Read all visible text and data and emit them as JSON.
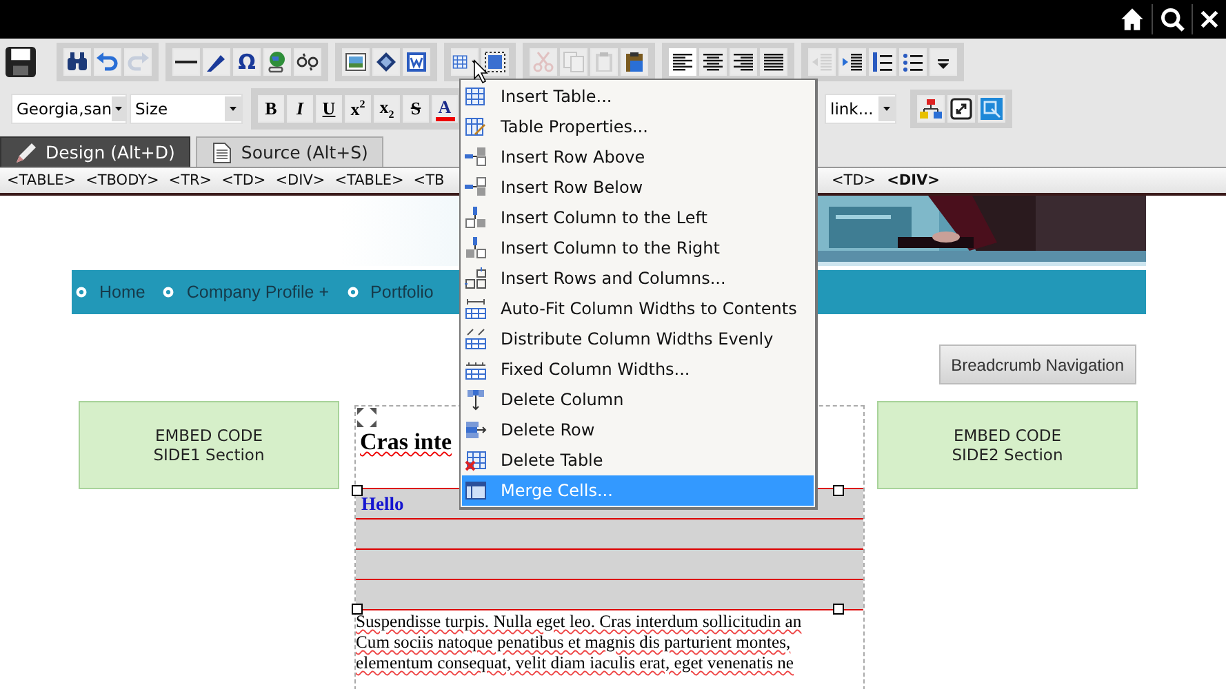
{
  "toolbar": {
    "row_1": [
      [
        {
          "disabled": false
        }
      ],
      [
        {
          "disabled": false
        },
        {
          "disabled": false
        },
        {
          "disabled": true
        }
      ],
      [
        {
          "disabled": false
        },
        {
          "disabled": false
        },
        {
          "label": "Ω",
          "disabled": false
        },
        {
          "disabled": false
        },
        {
          "disabled": false
        }
      ],
      [
        {
          "disabled": false
        },
        {
          "disabled": false
        },
        {
          "disabled": false
        }
      ],
      [
        {
          "disabled": false
        },
        {
          "disabled": false
        }
      ],
      [
        {
          "disabled": true
        },
        {
          "disabled": true
        },
        {
          "disabled": true
        },
        {
          "disabled": false
        }
      ],
      [
        {
          "disabled": false,
          "selected": true
        },
        {
          "disabled": false,
          "selected": false
        },
        {
          "disabled": false,
          "selected": false
        },
        {
          "disabled": false,
          "selected": false
        }
      ],
      [
        {
          "disabled": true
        },
        {
          "disabled": false
        },
        {
          "disabled": false
        },
        {
          "disabled": false
        },
        {
          "disabled": false
        }
      ]
    ],
    "font_select": {
      "value": "Georgia,san"
    },
    "size_select": {
      "value": "Size"
    },
    "format_buttons": [
      {
        "label": "B",
        "kind": "bold"
      },
      {
        "label": "I",
        "kind": "italic"
      },
      {
        "label": "U",
        "kind": "underline"
      },
      {
        "label": "x$^{2}$",
        "kind": "plain"
      },
      {
        "label": "x$_{2}$",
        "kind": "plain"
      },
      {
        "label": "S",
        "kind": "strike"
      },
      {
        "label": "A",
        "kind": "color"
      }
    ],
    "link_select": {
      "value": "link..."
    }
  },
  "tabs": [
    {
      "label": "Design (Alt+D)",
      "selected": true
    },
    {
      "label": "Source (Alt+S)",
      "selected": false
    }
  ],
  "tag_path": {
    "left": [
      {
        "label": "<TABLE>",
        "selected": false
      },
      {
        "label": "<TBODY>",
        "selected": false
      },
      {
        "label": "<TR>",
        "selected": false
      },
      {
        "label": "<TD>",
        "selected": false
      },
      {
        "label": "<DIV>",
        "selected": false
      },
      {
        "label": "<TABLE>",
        "selected": false
      },
      {
        "label": "<TB",
        "selected": false
      }
    ],
    "right": [
      {
        "label": "<TD>",
        "selected": false
      },
      {
        "label": "<DIV>",
        "selected": true
      }
    ]
  },
  "page": {
    "nav": [
      "Home",
      "Company Profile +",
      "Portfolio"
    ],
    "breadcrumb_button": "Breadcrumb Navigation",
    "side_boxes": [
      {
        "lines": [
          "EMBED CODE",
          "SIDE1 Section"
        ]
      },
      {
        "lines": [
          "EMBED CODE",
          "SIDE2 Section"
        ]
      }
    ],
    "heading": "Cras inte",
    "table_rows": [
      {
        "kind": "text",
        "cell": "Hello"
      },
      {
        "kind": "blank"
      },
      {
        "kind": "blank"
      },
      {
        "kind": "blank"
      }
    ],
    "paragraph_lines": [
      "Suspendisse turpis. Nulla eget leo. Cras interdum sollicitudin an",
      "Cum sociis natoque penatibus et magnis dis parturient montes,",
      "elementum consequat, velit diam iaculis erat, eget venenatis ne"
    ]
  },
  "context_menu": {
    "items": [
      {
        "label": "Insert Table...",
        "selected": false
      },
      {
        "label": "Table Properties...",
        "selected": false
      },
      {
        "label": "Insert Row Above",
        "selected": false
      },
      {
        "label": "Insert Row Below",
        "selected": false
      },
      {
        "label": "Insert Column to the Left",
        "selected": false
      },
      {
        "label": "Insert Column to the Right",
        "selected": false
      },
      {
        "label": "Insert Rows and Columns...",
        "selected": false
      },
      {
        "label": "Auto-Fit Column Widths to Contents",
        "selected": false
      },
      {
        "label": "Distribute Column Widths Evenly",
        "selected": false
      },
      {
        "label": "Fixed Column Widths...",
        "selected": false
      },
      {
        "label": "Delete Column",
        "selected": false
      },
      {
        "label": "Delete Row",
        "selected": false
      },
      {
        "label": "Delete Table",
        "selected": false
      },
      {
        "label": "Merge Cells...",
        "selected": true
      }
    ]
  }
}
